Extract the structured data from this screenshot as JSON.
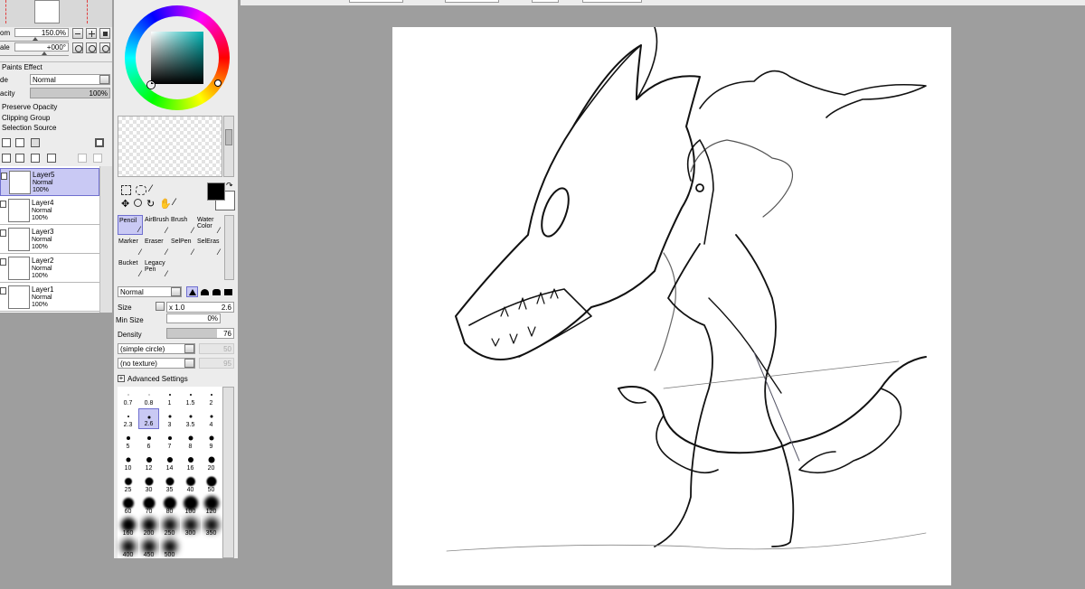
{
  "navigator": {
    "zoom_label": "om",
    "zoom_value": "150.0%",
    "angle_label": "ale",
    "angle_value": "+000",
    "angle_unit": "°"
  },
  "layer_props": {
    "section_title": "Paints Effect",
    "mode_label": "de",
    "mode_value": "Normal",
    "opacity_label": "acity",
    "opacity_value": "100%",
    "opacity_fraction": 1.0,
    "preserve_opacity": "Preserve Opacity",
    "clipping_group": "Clipping Group",
    "selection_source": "Selection Source"
  },
  "layers": [
    {
      "name": "Layer5",
      "mode": "Normal",
      "opacity": "100%",
      "selected": true
    },
    {
      "name": "Layer4",
      "mode": "Normal",
      "opacity": "100%",
      "selected": false
    },
    {
      "name": "Layer3",
      "mode": "Normal",
      "opacity": "100%",
      "selected": false
    },
    {
      "name": "Layer2",
      "mode": "Normal",
      "opacity": "100%",
      "selected": false
    },
    {
      "name": "Layer1",
      "mode": "Normal",
      "opacity": "100%",
      "selected": false
    }
  ],
  "tools": [
    {
      "label": "Pencil",
      "selected": true
    },
    {
      "label": "AirBrush",
      "selected": false
    },
    {
      "label": "Brush",
      "selected": false
    },
    {
      "label": "Water Color",
      "selected": false
    },
    {
      "label": "Marker",
      "selected": false
    },
    {
      "label": "Eraser",
      "selected": false
    },
    {
      "label": "SelPen",
      "selected": false
    },
    {
      "label": "SelEras",
      "selected": false
    },
    {
      "label": "Bucket",
      "selected": false
    },
    {
      "label": "Legacy Pen",
      "selected": false
    }
  ],
  "brush": {
    "blend_mode": "Normal",
    "size_label": "Size",
    "size_multiplier": "x 1.0",
    "size_value": "2.6",
    "min_size_label": "Min Size",
    "min_size_value": "0%",
    "density_label": "Density",
    "density_value": "76",
    "density_fraction": 0.76,
    "shape": "(simple circle)",
    "shape_value": "50",
    "texture": "(no texture)",
    "texture_value": "95",
    "advanced_settings": "Advanced Settings",
    "sizes": [
      "0.7",
      "0.8",
      "1",
      "1.5",
      "2",
      "2.3",
      "2.6",
      "3",
      "3.5",
      "4",
      "5",
      "6",
      "7",
      "8",
      "9",
      "10",
      "12",
      "14",
      "16",
      "20",
      "25",
      "30",
      "35",
      "40",
      "50",
      "60",
      "70",
      "80",
      "100",
      "120",
      "160",
      "200",
      "250",
      "300",
      "350",
      "400",
      "450",
      "500"
    ],
    "selected_size": "2.6"
  },
  "colors": {
    "primary": "#000000",
    "secondary": "#ffffff",
    "selected_hue": "#00b3b3",
    "selection_highlight": "#c9c9f4"
  }
}
